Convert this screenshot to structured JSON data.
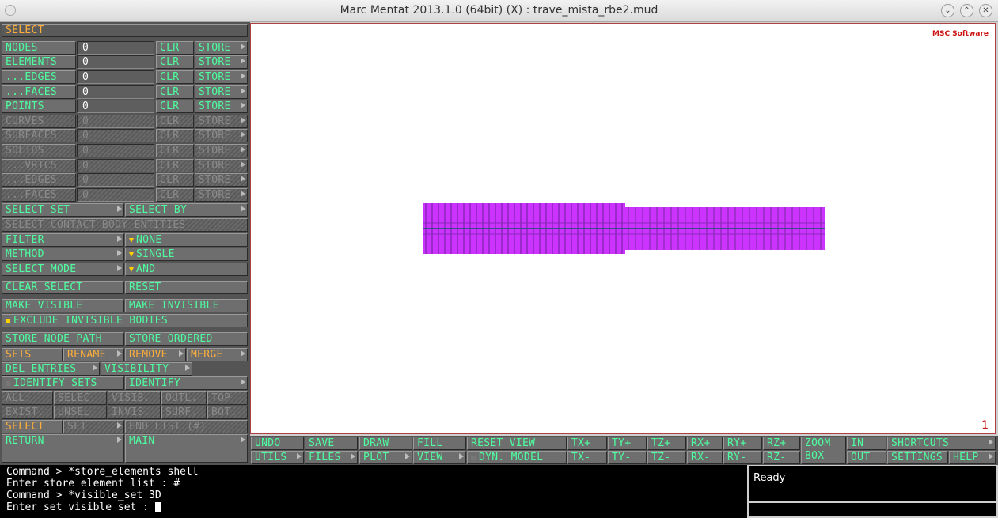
{
  "window": {
    "title": "Marc Mentat 2013.1.0 (64bit) (X) : trave_mista_rbe2.mud"
  },
  "panel": {
    "header": "SELECT",
    "rows": [
      {
        "label": "NODES",
        "value": "0",
        "clr": "CLR",
        "store": "STORE"
      },
      {
        "label": "ELEMENTS",
        "value": "0",
        "clr": "CLR",
        "store": "STORE"
      },
      {
        "label": "...EDGES",
        "value": "0",
        "clr": "CLR",
        "store": "STORE"
      },
      {
        "label": "...FACES",
        "value": "0",
        "clr": "CLR",
        "store": "STORE"
      },
      {
        "label": "POINTS",
        "value": "0",
        "clr": "CLR",
        "store": "STORE"
      },
      {
        "label": "CURVES",
        "value": "0",
        "clr": "CLR",
        "store": "STORE"
      },
      {
        "label": "SURFACES",
        "value": "0",
        "clr": "CLR",
        "store": "STORE"
      },
      {
        "label": "SOLIDS",
        "value": "0",
        "clr": "CLR",
        "store": "STORE"
      },
      {
        "label": "...VRTCS",
        "value": "0",
        "clr": "CLR",
        "store": "STORE"
      },
      {
        "label": "...EDGES",
        "value": "0",
        "clr": "CLR",
        "store": "STORE"
      },
      {
        "label": "...FACES",
        "value": "0",
        "clr": "CLR",
        "store": "STORE"
      }
    ],
    "select_set": "SELECT SET",
    "select_by": "SELECT BY",
    "select_contact": "SELECT CONTACT BODY ENTITIES",
    "filter_label": "FILTER",
    "filter_value": "NONE",
    "method_label": "METHOD",
    "method_value": "SINGLE",
    "mode_label": "SELECT MODE",
    "mode_value": "AND",
    "clear_select": "CLEAR SELECT",
    "reset": "RESET",
    "make_visible": "MAKE VISIBLE",
    "make_invisible": "MAKE INVISIBLE",
    "exclude_invisible": "EXCLUDE INVISIBLE BODIES",
    "store_node_path": "STORE NODE PATH",
    "store_ordered": "STORE ORDERED",
    "sets": "SETS",
    "rename": "RENAME",
    "remove": "REMOVE",
    "merge": "MERGE",
    "del_entries": "DEL ENTRIES",
    "visibility": "VISIBILITY",
    "identify_sets": "IDENTIFY SETS",
    "identify": "IDENTIFY",
    "row_a": [
      "ALL:",
      "SELEC.",
      "VISIB.",
      "OUTL.",
      "TOP"
    ],
    "row_b": [
      "EXIST.",
      "UNSEL.",
      "INVIS.",
      "SURF.",
      "BOT."
    ],
    "select2": "SELECT",
    "set": "SET",
    "end_list": "END LIST (#)",
    "return": "RETURN",
    "main": "MAIN"
  },
  "toolbar": {
    "undo": "UNDO",
    "save": "SAVE",
    "draw": "DRAW",
    "fill": "FILL",
    "reset_view": "RESET VIEW",
    "txp": "TX+",
    "typ": "TY+",
    "tzp": "TZ+",
    "rxp": "RX+",
    "ryp": "RY+",
    "rzp": "RZ+",
    "zoom": "ZOOM",
    "box": "BOX",
    "in": "IN",
    "shortcuts": "SHORTCUTS",
    "utils": "UTILS",
    "files": "FILES",
    "plot": "PLOT",
    "view": "VIEW",
    "dyn_model": "DYN. MODEL",
    "txm": "TX-",
    "tym": "TY-",
    "tzm": "TZ-",
    "rxm": "RX-",
    "rym": "RY-",
    "rzm": "RZ-",
    "out": "OUT",
    "settings": "SETTINGS",
    "help": "HELP"
  },
  "viewport": {
    "logo": "MSC Software",
    "number": "1"
  },
  "console": {
    "lines": [
      "Command > *store_elements shell",
      "Enter store element list : #",
      "Command > *visible_set 3D",
      "Enter set visible set : "
    ]
  },
  "status": {
    "text": "Ready"
  },
  "colors": {
    "model": "#cc33ff",
    "label_green": "#4dffa0",
    "label_orange": "#ffae3b",
    "accent_red": "#cc1010"
  }
}
